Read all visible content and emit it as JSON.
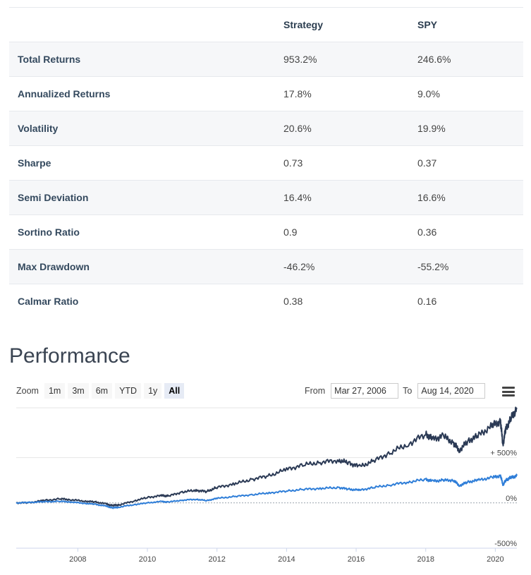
{
  "stats": {
    "headers": {
      "metric": "",
      "strategy": "Strategy",
      "spy": "SPY"
    },
    "rows": [
      {
        "metric": "Total Returns",
        "strategy": "953.2%",
        "spy": "246.6%"
      },
      {
        "metric": "Annualized Returns",
        "strategy": "17.8%",
        "spy": "9.0%"
      },
      {
        "metric": "Volatility",
        "strategy": "20.6%",
        "spy": "19.9%"
      },
      {
        "metric": "Sharpe",
        "strategy": "0.73",
        "spy": "0.37"
      },
      {
        "metric": "Semi Deviation",
        "strategy": "16.4%",
        "spy": "16.6%"
      },
      {
        "metric": "Sortino Ratio",
        "strategy": "0.9",
        "spy": "0.36"
      },
      {
        "metric": "Max Drawdown",
        "strategy": "-46.2%",
        "spy": "-55.2%"
      },
      {
        "metric": "Calmar Ratio",
        "strategy": "0.38",
        "spy": "0.16"
      }
    ]
  },
  "performance": {
    "title": "Performance",
    "zoom_label": "Zoom",
    "zoom_buttons": [
      "1m",
      "3m",
      "6m",
      "YTD",
      "1y",
      "All"
    ],
    "zoom_active": "All",
    "from_label": "From",
    "from_value": "Mar 27, 2006",
    "to_label": "To",
    "to_value": "Aug 14, 2020",
    "menu_icon": "hamburger-menu-icon"
  },
  "chart_data": {
    "type": "line",
    "title": "",
    "xlabel": "",
    "ylabel": "",
    "x_range": [
      2006.23,
      2020.62
    ],
    "y_range": [
      -500,
      1050
    ],
    "x_ticks": [
      "2008",
      "2010",
      "2012",
      "2014",
      "2016",
      "2018",
      "2020"
    ],
    "y_ticks": [
      {
        "value": 500,
        "label": "+ 500%"
      },
      {
        "value": 0,
        "label": "0%"
      },
      {
        "value": -500,
        "label": "-500%"
      }
    ],
    "grid": true,
    "legend": "none",
    "series": [
      {
        "color": "#2b3a55",
        "x": [
          2006.23,
          2006.6,
          2007.0,
          2007.5,
          2007.8,
          2008.2,
          2008.5,
          2008.8,
          2009.0,
          2009.2,
          2009.6,
          2010.0,
          2010.4,
          2010.6,
          2011.0,
          2011.4,
          2011.7,
          2012.0,
          2012.5,
          2013.0,
          2013.5,
          2014.0,
          2014.5,
          2015.0,
          2015.5,
          2015.8,
          2016.1,
          2016.5,
          2017.0,
          2017.5,
          2018.0,
          2018.2,
          2018.5,
          2018.8,
          2018.97,
          2019.2,
          2019.5,
          2019.9,
          2020.15,
          2020.22,
          2020.3,
          2020.45,
          2020.62
        ],
        "y": [
          0,
          2,
          25,
          45,
          35,
          20,
          10,
          -10,
          -30,
          -20,
          20,
          60,
          80,
          75,
          120,
          140,
          125,
          170,
          210,
          260,
          300,
          370,
          420,
          450,
          470,
          440,
          400,
          460,
          560,
          650,
          760,
          700,
          740,
          660,
          580,
          680,
          740,
          850,
          900,
          640,
          820,
          930,
          1040
        ]
      },
      {
        "color": "#2f7ed8",
        "x": [
          2006.23,
          2006.6,
          2007.0,
          2007.5,
          2007.8,
          2008.2,
          2008.5,
          2008.8,
          2009.0,
          2009.2,
          2009.6,
          2010.0,
          2010.4,
          2010.6,
          2011.0,
          2011.4,
          2011.7,
          2012.0,
          2012.5,
          2013.0,
          2013.5,
          2014.0,
          2014.5,
          2015.0,
          2015.5,
          2015.8,
          2016.1,
          2016.5,
          2017.0,
          2017.5,
          2018.0,
          2018.2,
          2018.5,
          2018.8,
          2018.97,
          2019.2,
          2019.5,
          2019.9,
          2020.15,
          2020.22,
          2020.3,
          2020.45,
          2020.62
        ],
        "y": [
          0,
          5,
          12,
          18,
          10,
          -5,
          -15,
          -35,
          -55,
          -45,
          -20,
          0,
          15,
          10,
          30,
          40,
          25,
          50,
          70,
          90,
          110,
          130,
          150,
          160,
          170,
          150,
          140,
          170,
          200,
          230,
          260,
          240,
          250,
          250,
          190,
          230,
          250,
          280,
          300,
          200,
          250,
          280,
          300
        ]
      }
    ]
  }
}
